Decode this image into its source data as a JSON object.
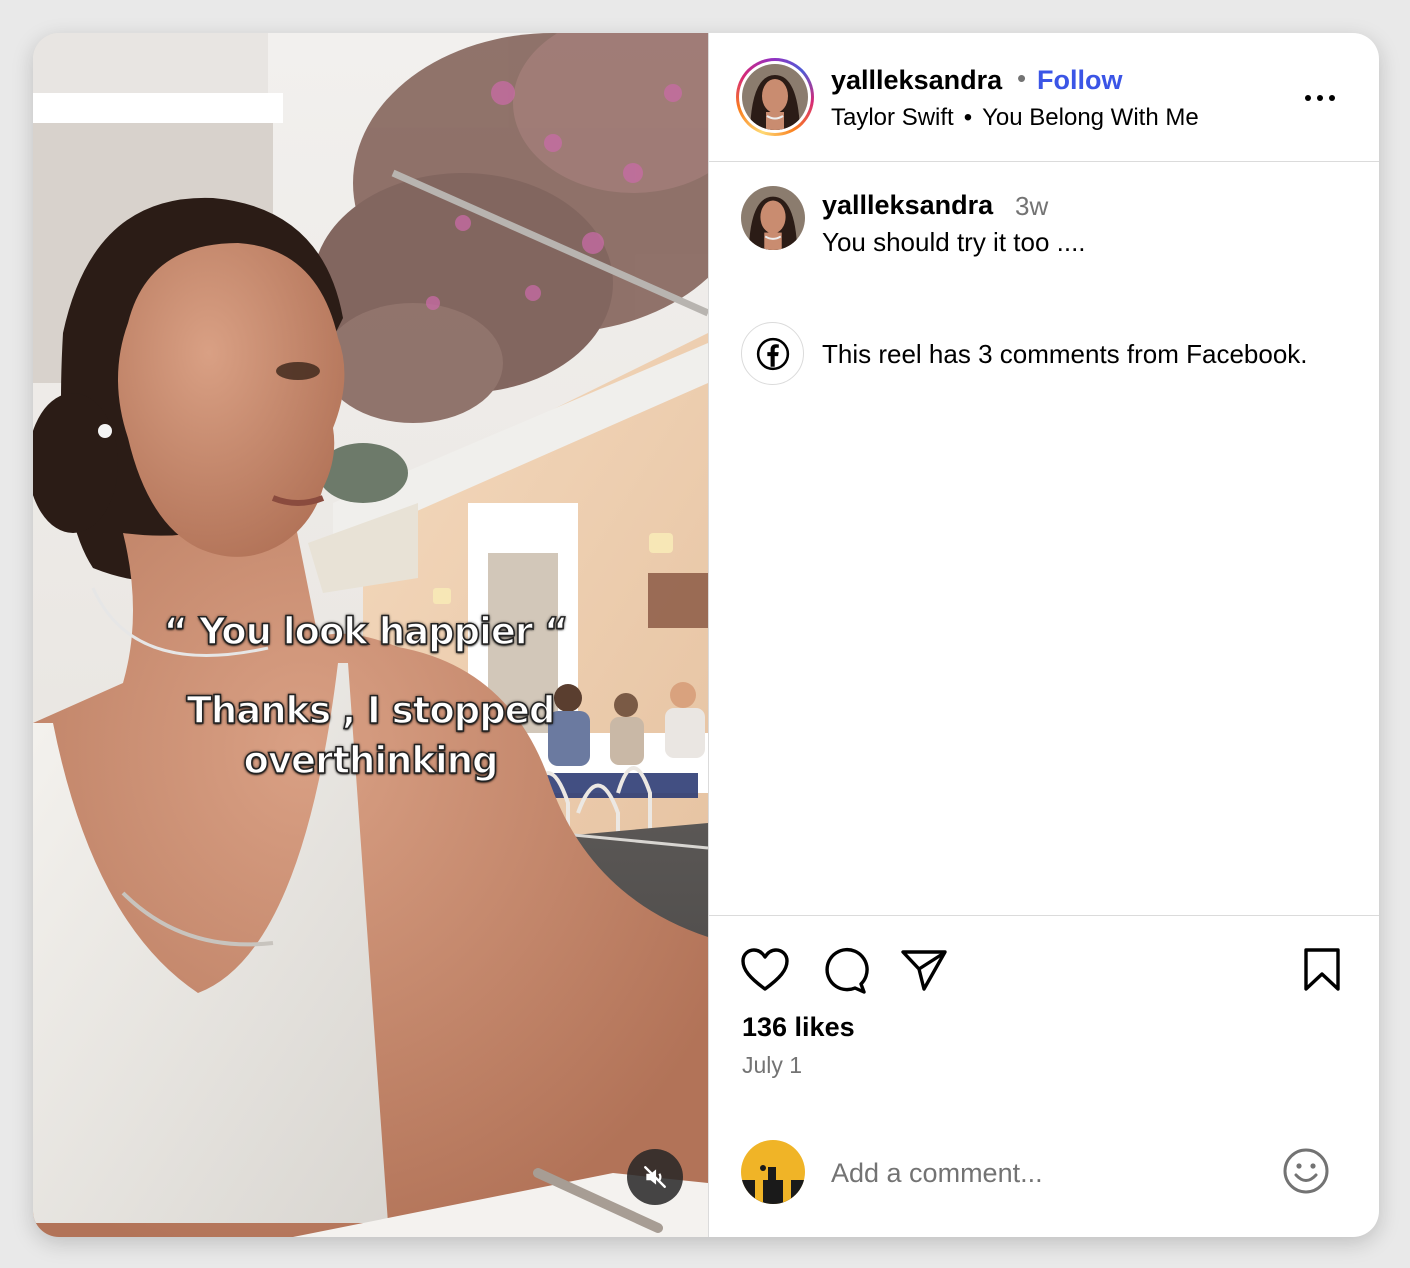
{
  "post": {
    "username": "yallleksandra",
    "follow_label": "Follow",
    "separator_dot": "•",
    "music_artist": "Taylor Swift",
    "music_bullet": "•",
    "music_title": "You Belong With Me",
    "more_icon": "more-horizontal-icon"
  },
  "media": {
    "overlay_line1": "“ You look happier “",
    "overlay_line2": "Thanks , I stopped",
    "overlay_line3": "overthinking",
    "mute_icon": "muted-speaker-icon"
  },
  "caption": {
    "username": "yallleksandra",
    "time": "3w",
    "text": "You should try it too ...."
  },
  "facebook_note": {
    "icon": "facebook-icon",
    "text": "This reel has 3 comments from Facebook."
  },
  "actions": {
    "like_icon": "heart-icon",
    "comment_icon": "comment-icon",
    "share_icon": "send-icon",
    "save_icon": "bookmark-icon",
    "likes": "136 likes",
    "date": "July 1"
  },
  "comment_box": {
    "placeholder": "Add a comment...",
    "emoji_icon": "emoji-smile-icon"
  },
  "colors": {
    "follow": "#3b55e6",
    "secondary_text": "#737373",
    "divider": "#dbdbdb",
    "me_avatar": "#f0b427"
  }
}
